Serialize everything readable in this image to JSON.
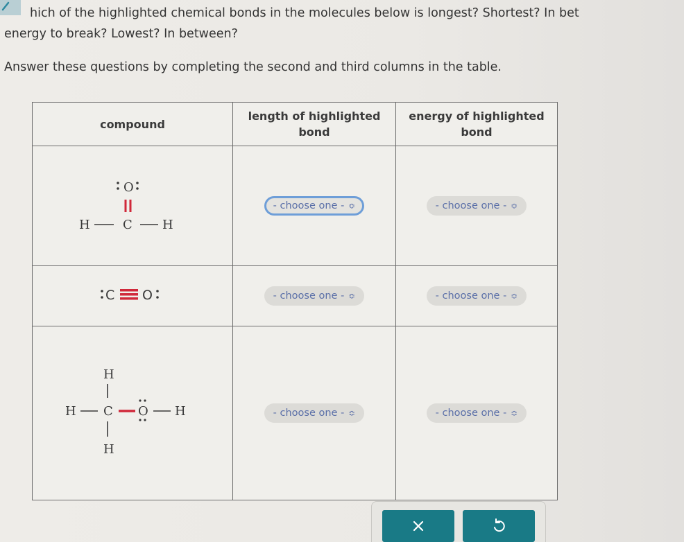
{
  "question": {
    "line1": "hich of the highlighted chemical bonds in the molecules below is longest? Shortest? In bet",
    "line2": "energy to break? Lowest? In between?",
    "line3": "Answer these questions by completing the second and third columns in the table."
  },
  "table": {
    "headers": [
      "compound",
      "length of highlighted bond",
      "energy of highlighted bond"
    ],
    "rows": [
      {
        "compound": "formaldehyde H2C=O (C=O double bond highlighted)",
        "atoms": {
          "top": "O",
          "center": "C",
          "left": "H",
          "right": "H"
        },
        "length_select": "- choose one -",
        "energy_select": "- choose one -"
      },
      {
        "compound": "carbon monoxide C≡O (triple bond highlighted)",
        "atoms": {
          "left": "C",
          "right": "O"
        },
        "length_select": "- choose one -",
        "energy_select": "- choose one -"
      },
      {
        "compound": "methanol CH3-OH (C-O single bond highlighted)",
        "atoms": {
          "top": "H",
          "bottom": "H",
          "left": "H",
          "center": "C",
          "o": "O",
          "right": "H"
        },
        "length_select": "- choose one -",
        "energy_select": "- choose one -"
      }
    ]
  },
  "actions": {
    "clear_icon": "×",
    "undo_icon": "undo"
  },
  "colors": {
    "highlight_bond": "#d0283a",
    "select_text": "#5a6fa8",
    "button_bg": "#197a86",
    "focus_ring": "#6e9ed8"
  }
}
